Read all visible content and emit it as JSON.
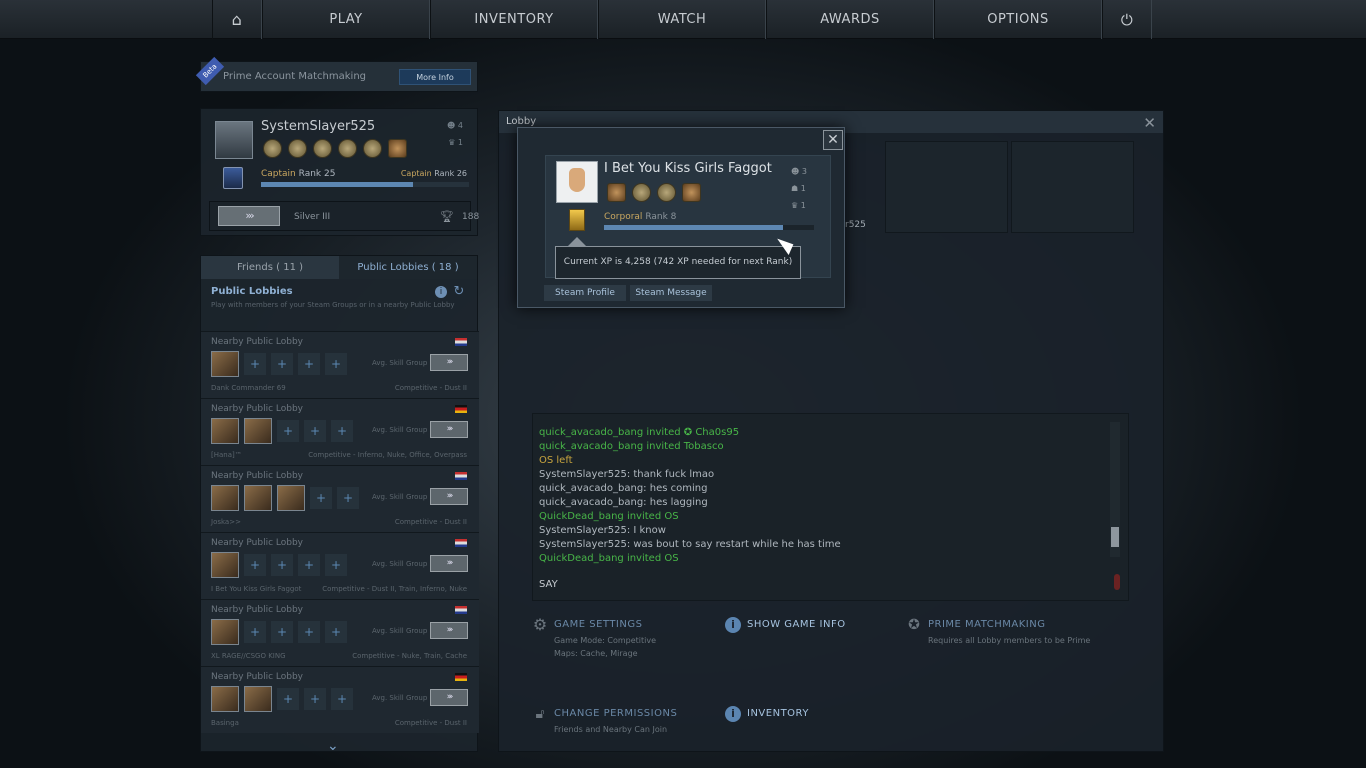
{
  "nav": {
    "home_icon": "home-icon",
    "items": [
      "PLAY",
      "INVENTORY",
      "WATCH",
      "AWARDS",
      "OPTIONS"
    ],
    "power_icon": "power-icon"
  },
  "prime_banner": {
    "beta": "Beta",
    "text": "Prime Account Matchmaking",
    "button": "More Info"
  },
  "profile": {
    "name": "SystemSlayer525",
    "stat1": "4",
    "stat2": "1",
    "rank_title": "Captain",
    "rank_text": "Rank 25",
    "next_title": "Captain",
    "next_rank": "Rank 26",
    "xp_fraction": 0.73,
    "skill_group": "Silver III",
    "trophies": "188"
  },
  "social": {
    "tab_friends": "Friends ( 11 )",
    "tab_public": "Public Lobbies ( 18 )",
    "title": "Public Lobbies",
    "subtitle": "Play with members of your Steam Groups or in a nearby Public Lobby",
    "avg_label": "Avg. Skill Group",
    "lobbies": [
      {
        "title": "Nearby Public Lobby",
        "owner": "Dank Commander 69",
        "mode": "Competitive - Dust II"
      },
      {
        "title": "Nearby Public Lobby",
        "owner": "[Hana]™",
        "mode": "Competitive - Inferno, Nuke, Office, Overpass"
      },
      {
        "title": "Nearby Public Lobby",
        "owner": "Joska>>",
        "mode": "Competitive - Dust II"
      },
      {
        "title": "Nearby Public Lobby",
        "owner": "I Bet You Kiss Girls Faggot",
        "mode": "Competitive - Dust II, Train, Inferno, Nuke"
      },
      {
        "title": "Nearby Public Lobby",
        "owner": "XL RAGE//CSGO KING",
        "mode": "Competitive - Nuke, Train, Cache"
      },
      {
        "title": "Nearby Public Lobby",
        "owner": "Basinga",
        "mode": "Competitive - Dust II"
      }
    ]
  },
  "lobby": {
    "header": "Lobby",
    "partial_name": "r525",
    "chat": [
      {
        "text": "quick_avacado_bang invited ✪ Cha0s95",
        "color": "green"
      },
      {
        "text": "quick_avacado_bang invited Tobasco",
        "color": "green"
      },
      {
        "text": "OS left",
        "color": "gold"
      },
      {
        "text": "SystemSlayer525: thank fuck lmao",
        "color": "grey"
      },
      {
        "text": "quick_avacado_bang: hes coming",
        "color": "grey"
      },
      {
        "text": "quick_avacado_bang: hes lagging",
        "color": "grey"
      },
      {
        "text": "QuickDead_bang invited OS",
        "color": "green"
      },
      {
        "text": "SystemSlayer525: I know",
        "color": "grey"
      },
      {
        "text": "SystemSlayer525: was bout to say restart while he has time",
        "color": "grey"
      },
      {
        "text": "QuickDead_bang invited OS",
        "color": "green"
      }
    ],
    "say_label": "SAY",
    "game_settings": "GAME SETTINGS",
    "game_mode": "Game Mode: Competitive",
    "maps": "Maps: Cache, Mirage",
    "show_game_info": "SHOW GAME INFO",
    "prime_mm": "PRIME MATCHMAKING",
    "prime_mm_sub": "Requires all Lobby members to be Prime",
    "change_permissions": "CHANGE PERMISSIONS",
    "permissions_sub": "Friends and Nearby Can Join",
    "inventory": "INVENTORY"
  },
  "popup": {
    "name": "I Bet You Kiss Girls Faggot",
    "stat1": "3",
    "stat2": "1",
    "stat3": "1",
    "rank_title": "Corporal",
    "rank_text": "Rank 8",
    "xp_fraction": 0.85,
    "tooltip": "Current XP is 4,258 (742 XP needed for next Rank)",
    "btn_profile": "Steam Profile",
    "btn_message": "Steam Message"
  },
  "colors": {
    "green": "#48b548",
    "gold": "#c8a53f",
    "grey": "#b0b8bf",
    "accent": "#5d87b2"
  }
}
